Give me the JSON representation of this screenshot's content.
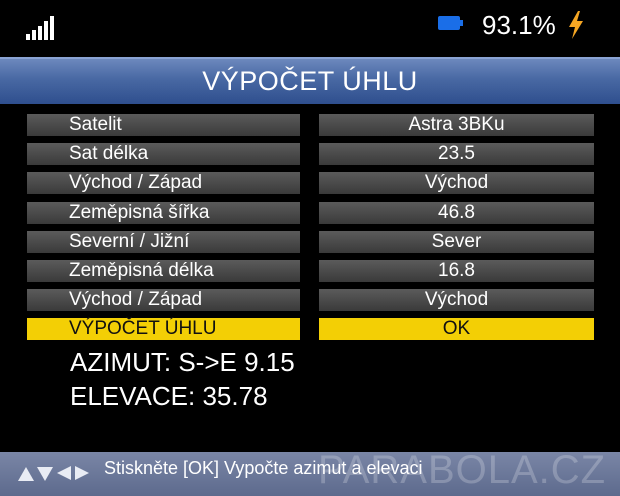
{
  "status": {
    "signal_icon": "signal-bars-icon",
    "battery_icon": "battery-icon",
    "battery_percent": "93.1%",
    "charging_icon": "charging-bolt-icon"
  },
  "title": "VÝPOČET ÚHLU",
  "rows": [
    {
      "label": "Satelit",
      "value": "Astra 3BKu"
    },
    {
      "label": "Sat délka",
      "value": "23.5"
    },
    {
      "label": "Východ / Západ",
      "value": "Východ"
    },
    {
      "label": "Zeměpisná šířka",
      "value": "46.8"
    },
    {
      "label": "Severní / Jižní",
      "value": "Sever"
    },
    {
      "label": "Zeměpisná délka",
      "value": "16.8"
    },
    {
      "label": "Východ / Západ",
      "value": "Východ"
    },
    {
      "label": "VÝPOČET ÚHLU",
      "value": "OK"
    }
  ],
  "selected_row": "VÝPOČET ÚHLU",
  "results": {
    "azimuth": "AZIMUT: S->E 9.15",
    "elevation": "ELEVACE: 35.78"
  },
  "help": {
    "arrows_icon": "navigation-arrows-icon",
    "text": "Stiskněte [OK] Vypočte azimut a elevaci"
  },
  "watermark": "PARABOLA.CZ",
  "colors": {
    "highlight": "#f3cf05",
    "title_bar": "#4868a3",
    "battery": "#1a6ee8",
    "bolt": "#f5a623"
  }
}
